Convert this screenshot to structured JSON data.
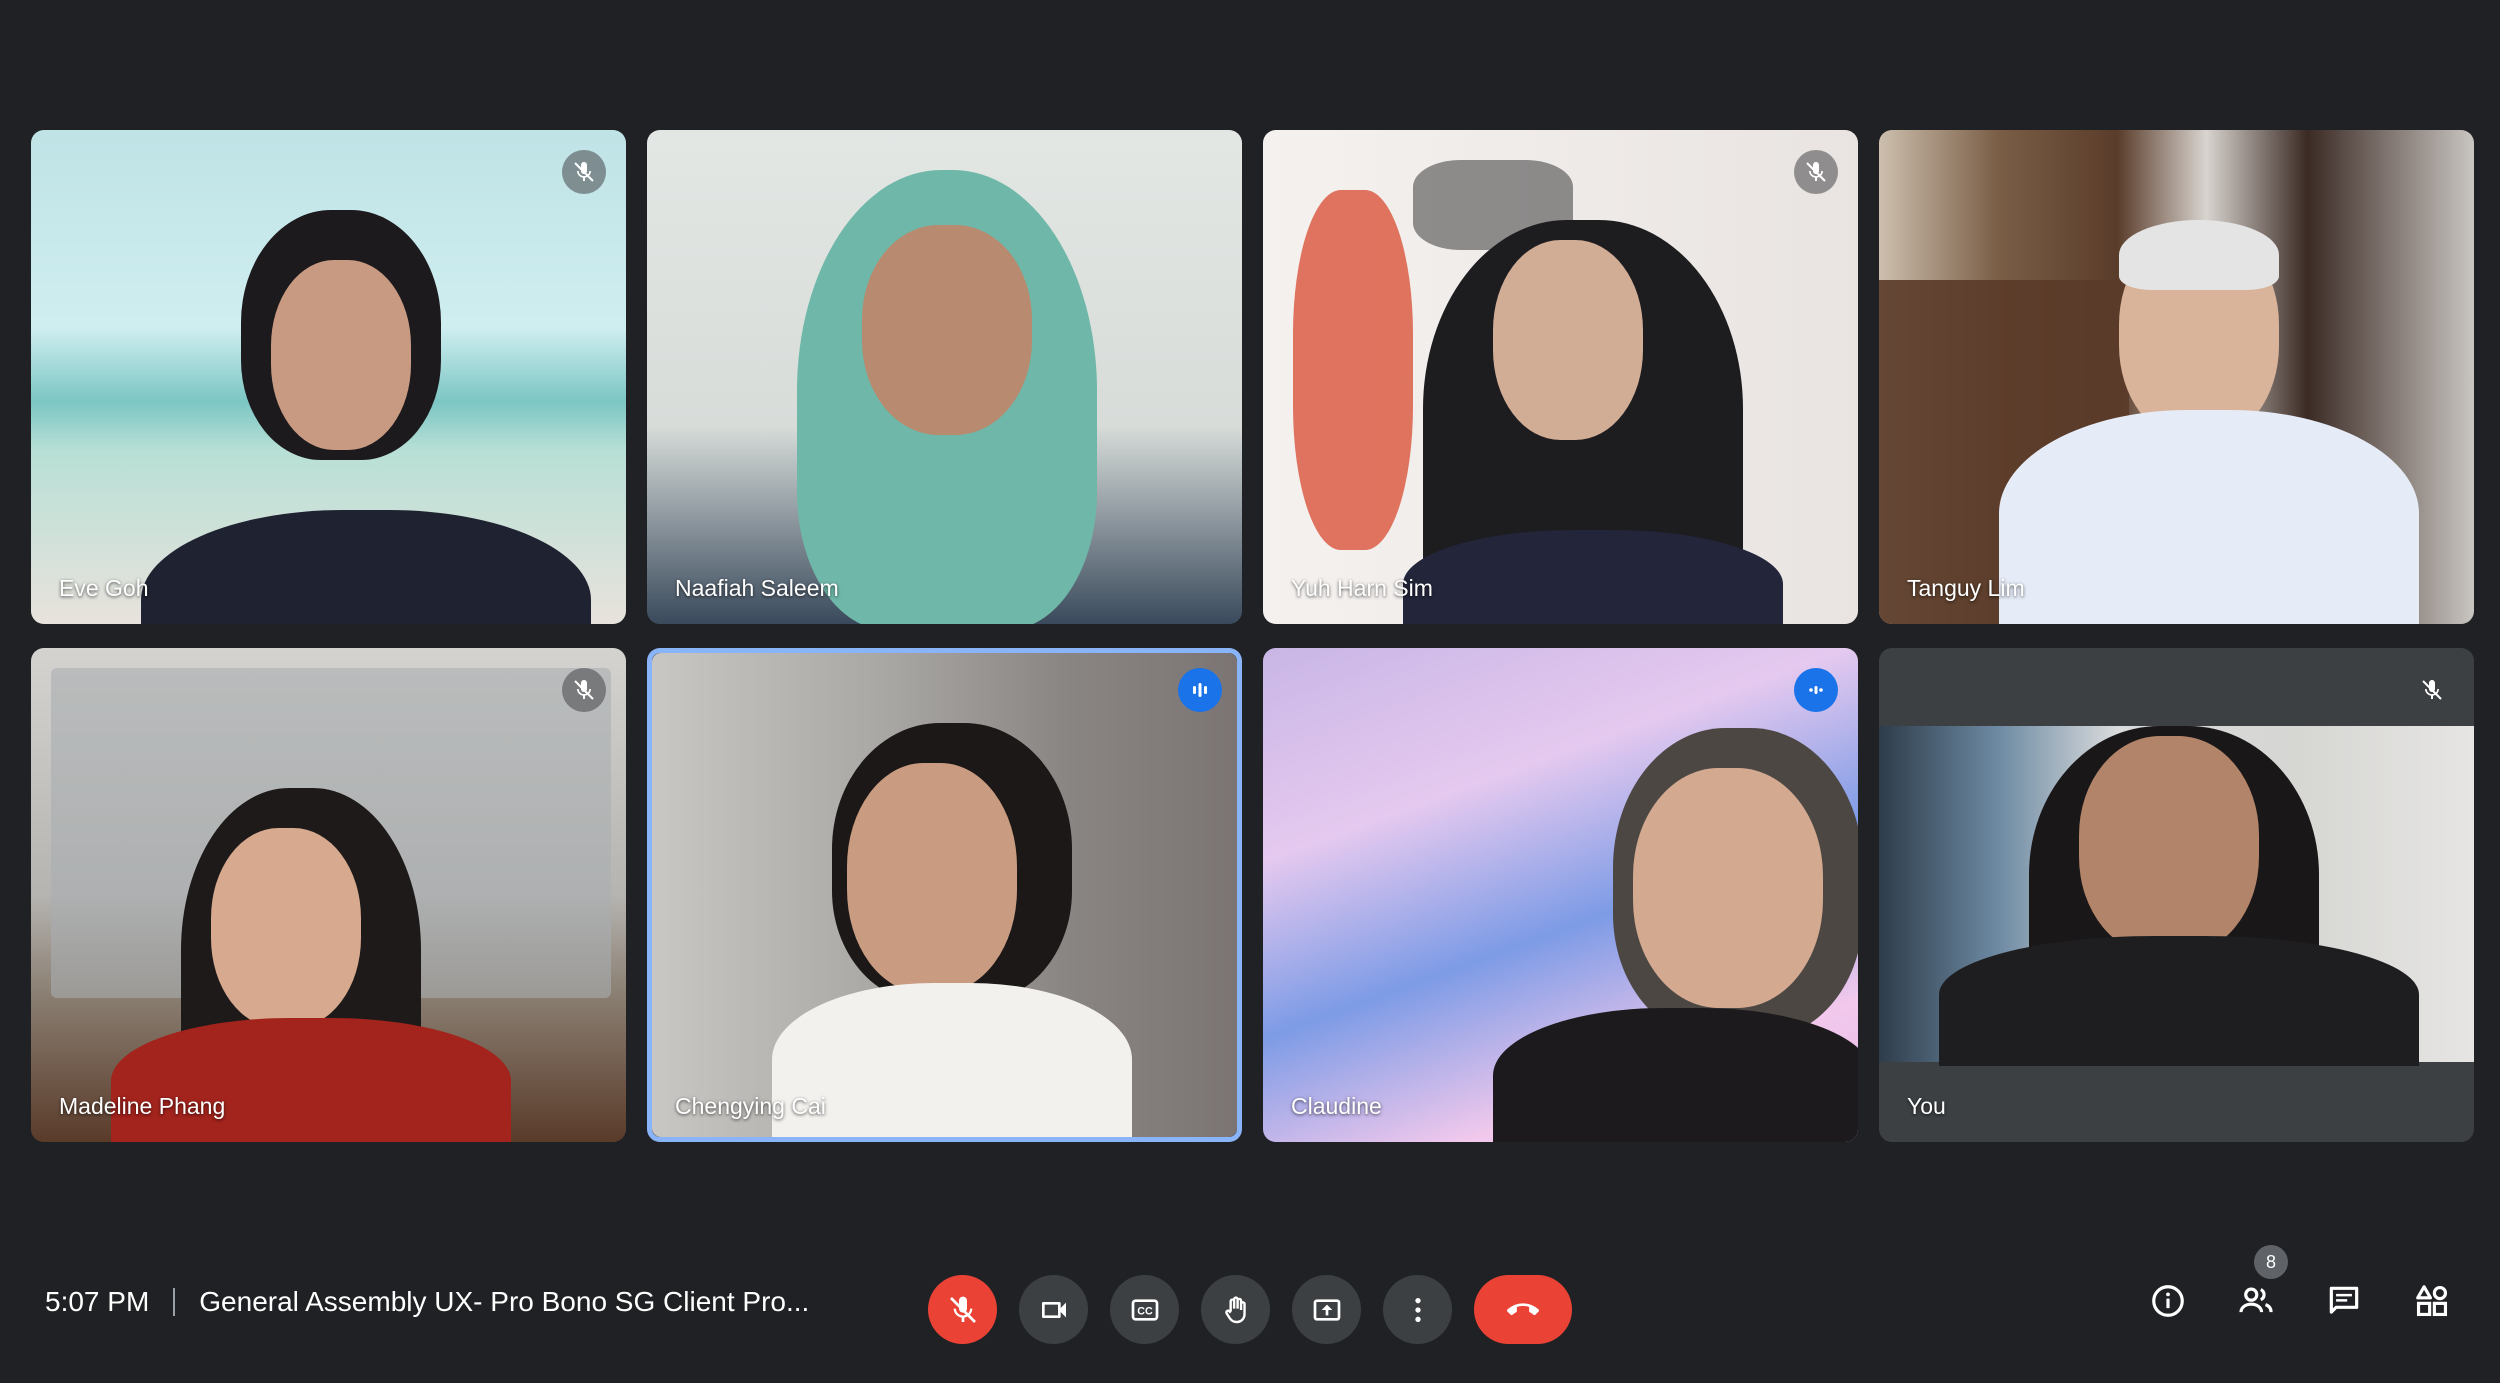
{
  "meeting": {
    "time": "5:07 PM",
    "title": "General Assembly UX- Pro Bono SG Client Pro..."
  },
  "participants": [
    {
      "name": "Eve Goh",
      "status": "muted"
    },
    {
      "name": "Naafiah Saleem",
      "status": "unmuted"
    },
    {
      "name": "Yuh Harn Sim",
      "status": "muted"
    },
    {
      "name": "Tanguy Lim",
      "status": "unmuted"
    },
    {
      "name": "Madeline Phang",
      "status": "muted"
    },
    {
      "name": "Chengying Cai",
      "status": "speaking"
    },
    {
      "name": "Claudine",
      "status": "speaking"
    },
    {
      "name": "You",
      "status": "muted"
    }
  ],
  "controls": [
    "mic-off-icon",
    "camera-icon",
    "captions-icon",
    "raise-hand-icon",
    "present-icon",
    "more-options-icon",
    "end-call-icon"
  ],
  "right_controls": {
    "people_count": "8",
    "icons": [
      "info-icon",
      "people-icon",
      "chat-icon",
      "activities-icon"
    ]
  },
  "colors": {
    "background": "#202124",
    "control": "#3c4043",
    "danger": "#ea4335",
    "speaking": "#1a73e8",
    "active_border": "#8ab4f8"
  }
}
